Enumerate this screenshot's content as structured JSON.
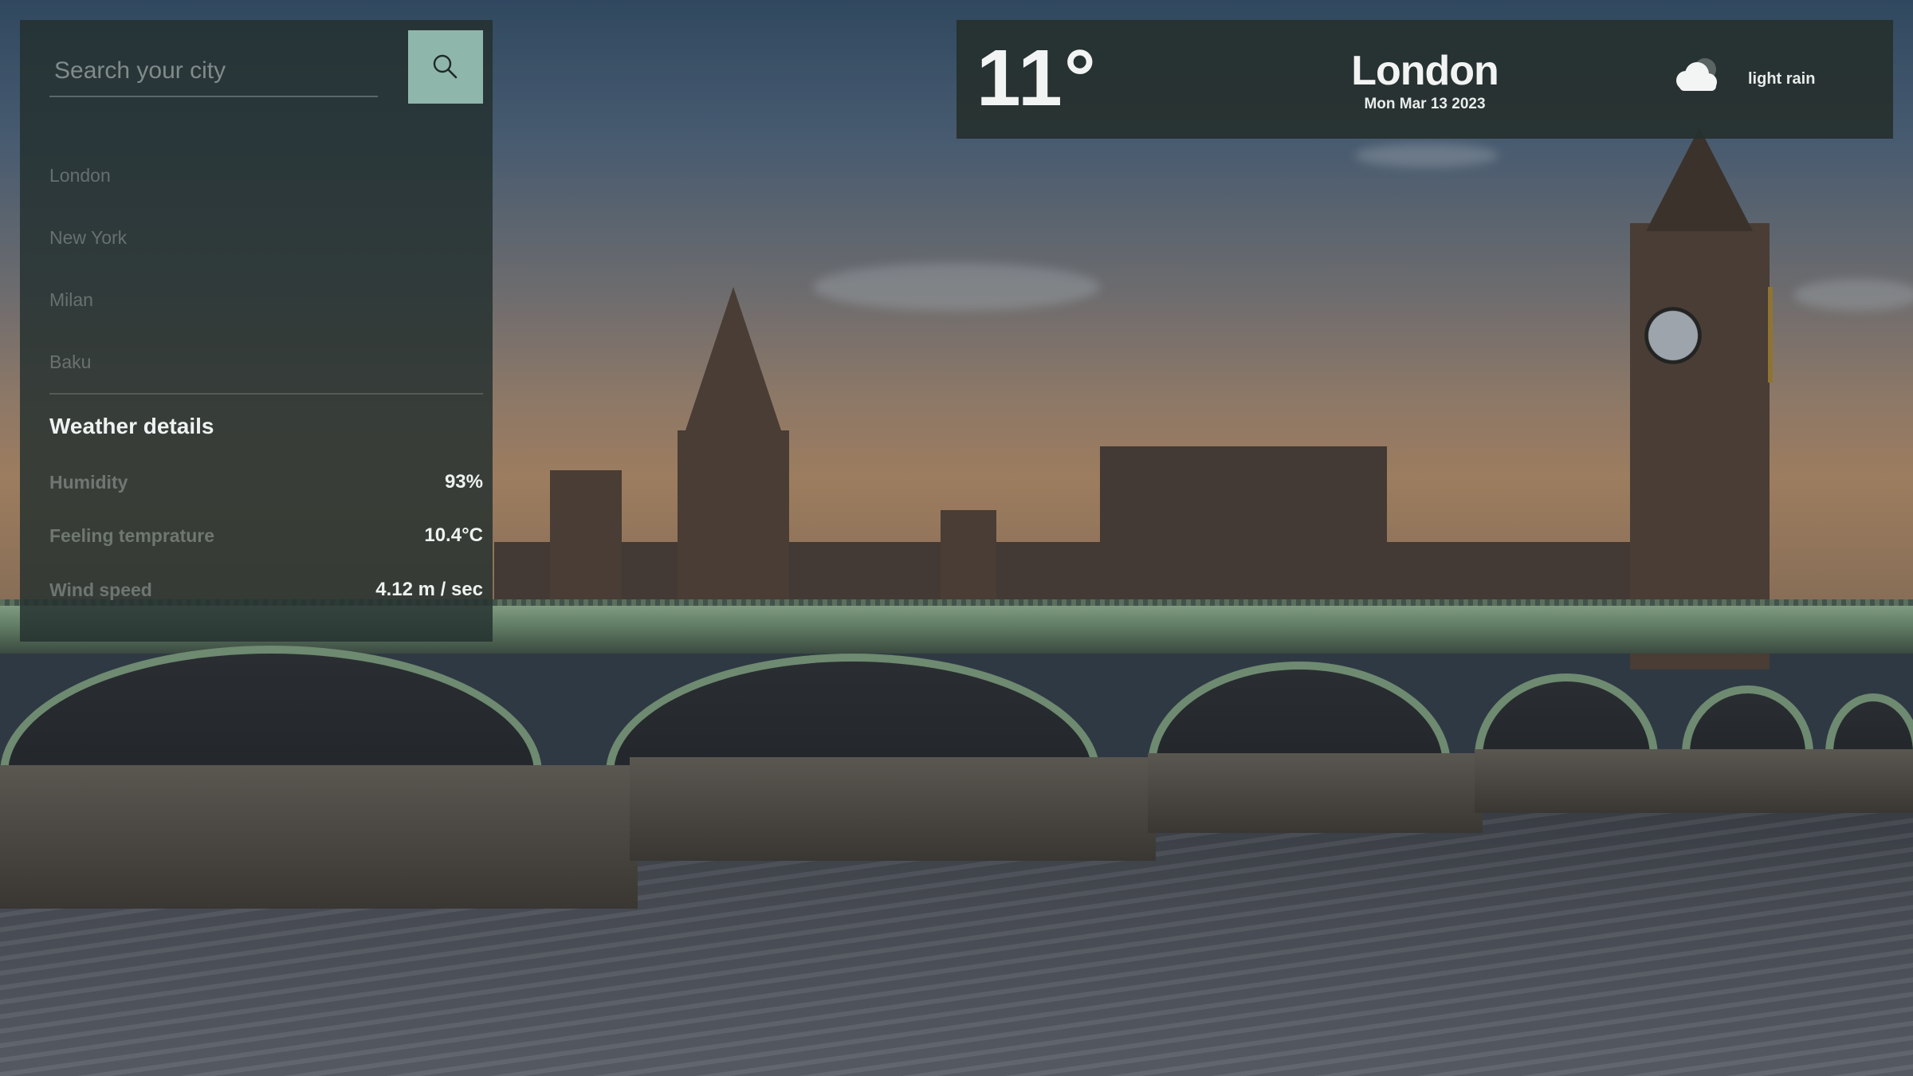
{
  "colors": {
    "panel_bg": "#23302e",
    "search_button_bg": "#8fb6aa",
    "topbar_bg": "#26302e",
    "text_primary": "#f2f4f3",
    "text_muted": "#aab4b2"
  },
  "search": {
    "placeholder": "Search your city",
    "value": "",
    "button_icon": "search-icon"
  },
  "cities": [
    "London",
    "New York",
    "Milan",
    "Baku"
  ],
  "details": {
    "title": "Weather details",
    "rows": [
      {
        "label": "Humidity",
        "value": "93%"
      },
      {
        "label": "Feeling temprature",
        "value": "10.4°C"
      },
      {
        "label": "Wind speed",
        "value": "4.12 m / sec"
      }
    ]
  },
  "current": {
    "temperature": "11°",
    "city": "London",
    "date": "Mon Mar 13 2023",
    "condition": "light rain",
    "condition_icon": "cloud-rain-icon"
  }
}
